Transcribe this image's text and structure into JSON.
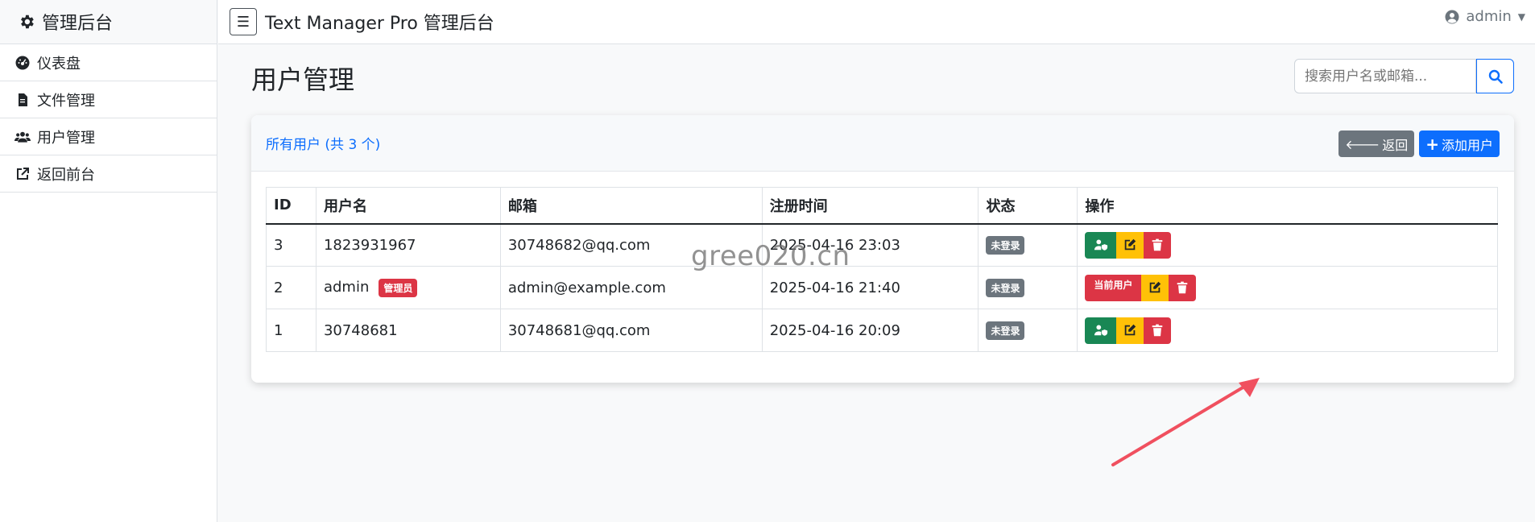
{
  "sidebar": {
    "brand": "管理后台",
    "items": [
      {
        "label": "仪表盘",
        "icon": "dashboard-icon"
      },
      {
        "label": "文件管理",
        "icon": "file-icon"
      },
      {
        "label": "用户管理",
        "icon": "users-icon"
      },
      {
        "label": "返回前台",
        "icon": "external-link-icon"
      }
    ]
  },
  "topbar": {
    "toggle_icon": "☰",
    "title": "Text Manager Pro 管理后台",
    "user": "admin"
  },
  "page": {
    "title": "用户管理",
    "search_placeholder": "搜索用户名或邮箱..."
  },
  "card": {
    "title": "所有用户 (共 3 个)",
    "back_label": "返回",
    "add_label": "添加用户"
  },
  "table": {
    "headers": [
      "ID",
      "用户名",
      "邮箱",
      "注册时间",
      "状态",
      "操作"
    ],
    "rows": [
      {
        "id": "3",
        "username": "1823931967",
        "email": "30748682@qq.com",
        "registered": "2025-04-16 23:03",
        "status": "未登录"
      },
      {
        "id": "2",
        "username": "admin",
        "admin_badge": "管理员",
        "email": "admin@example.com",
        "registered": "2025-04-16 21:40",
        "status": "未登录",
        "current_label": "当前用户"
      },
      {
        "id": "1",
        "username": "30748681",
        "email": "30748681@qq.com",
        "registered": "2025-04-16 20:09",
        "status": "未登录"
      }
    ]
  },
  "watermark": "gree020.cn",
  "colors": {
    "primary": "#0d6efd",
    "secondary": "#6c757d",
    "success": "#198754",
    "warning": "#ffc107",
    "danger": "#dc3545",
    "arrow": "#f0505f"
  }
}
